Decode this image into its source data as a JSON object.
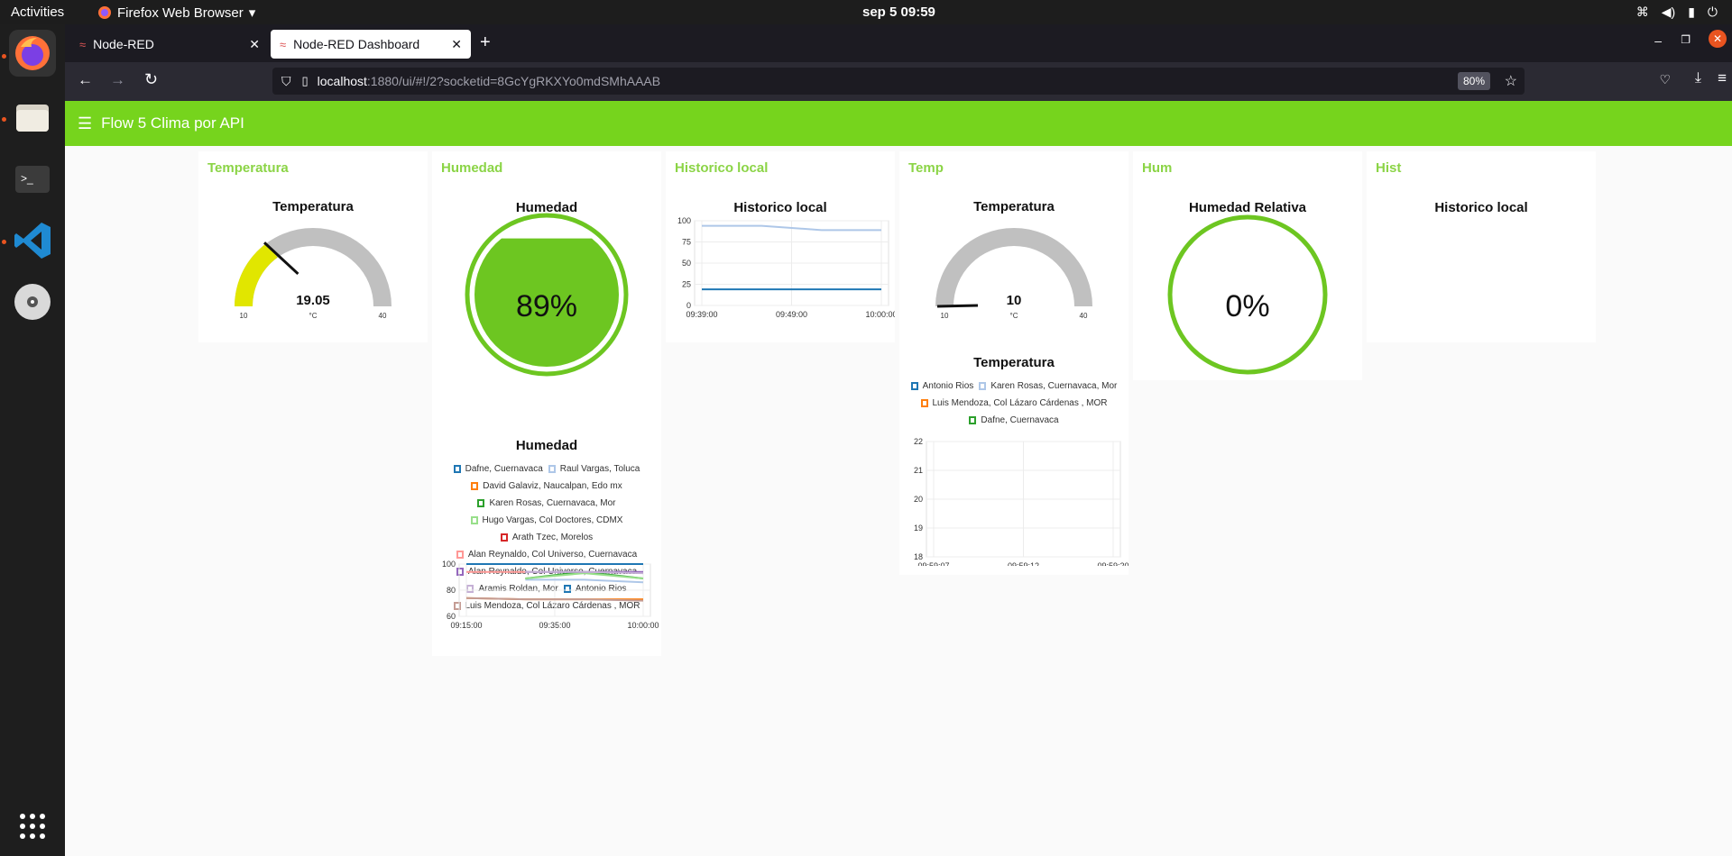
{
  "desktop": {
    "activities": "Activities",
    "app_name": "Firefox Web Browser",
    "clock": "sep 5  09:59"
  },
  "browser": {
    "tabs": [
      {
        "label": "Node-RED",
        "active": false
      },
      {
        "label": "Node-RED Dashboard",
        "active": true
      }
    ],
    "url_host": "localhost",
    "url_rest": ":1880/ui/#!/2?socketid=8GcYgRKXYo0mdSMhAAAB",
    "zoom": "80%"
  },
  "dashboard": {
    "title": "Flow 5 Clima por API",
    "groups": [
      {
        "title": "Temperatura",
        "widgets": [
          {
            "type": "gauge",
            "label": "Temperatura",
            "value": "19.05",
            "unit": "°C",
            "min": "10",
            "max": "40",
            "level": 0.3
          }
        ]
      },
      {
        "title": "Humedad",
        "widgets": [
          {
            "type": "level",
            "label": "Humedad",
            "value": "89%",
            "level": 0.89
          },
          {
            "type": "chart",
            "label": "Humedad"
          }
        ]
      },
      {
        "title": "Historico local",
        "widgets": [
          {
            "type": "chart",
            "label": "Historico local"
          }
        ]
      },
      {
        "title": "Temp",
        "widgets": [
          {
            "type": "gauge",
            "label": "Temperatura",
            "value": "10",
            "unit": "°C",
            "min": "10",
            "max": "40",
            "level": 0.0
          },
          {
            "type": "chart",
            "label": "Temperatura"
          }
        ]
      },
      {
        "title": "Hum",
        "widgets": [
          {
            "type": "level",
            "label": "Humedad Relativa",
            "value": "0%",
            "level": 0.0
          }
        ]
      },
      {
        "title": "Hist",
        "widgets": [
          {
            "type": "chart",
            "label": "Historico local"
          }
        ]
      }
    ]
  },
  "chart_data": [
    {
      "type": "line",
      "title": "Humedad",
      "x": [
        "09:15:00",
        "09:35:00",
        "10:00:00"
      ],
      "ylim": [
        60,
        100
      ],
      "yticks": [
        "100",
        "80",
        "60"
      ],
      "series": [
        {
          "name": "Dafne, Cuernavaca",
          "color": "#1f77b4",
          "values": [
            100,
            100,
            100,
            100
          ]
        },
        {
          "name": "Raul Vargas, Toluca",
          "color": "#aec7e8",
          "values": [
            null,
            88,
            88,
            86
          ]
        },
        {
          "name": "David Galaviz, Naucalpan, Edo mx",
          "color": "#ff7f0e",
          "values": [
            74,
            73,
            73,
            73
          ]
        },
        {
          "name": "Karen Rosas, Cuernavaca, Mor",
          "color": "#2ca02c",
          "values": [
            null,
            89,
            94,
            89
          ]
        },
        {
          "name": "Hugo Vargas, Col Doctores, CDMX",
          "color": "#98df8a",
          "values": [
            null,
            89,
            93,
            89
          ]
        },
        {
          "name": "Arath Tzec, Morelos",
          "color": "#d62728",
          "values": [
            null,
            null,
            null,
            null
          ]
        },
        {
          "name": "Alan Reynaldo, Col Universo, Cuernavaca",
          "color": "#ff9896",
          "values": [
            94,
            94,
            null,
            null
          ]
        },
        {
          "name": "Alan Reynaldo, Col Universo, Cuernavaca",
          "color": "#9467bd",
          "values": [
            null,
            94,
            94,
            94
          ]
        },
        {
          "name": "Aramis Roldan, Mor",
          "color": "#c5b0d5",
          "values": [
            null,
            94,
            94,
            93
          ]
        },
        {
          "name": "Antonio Rios",
          "color": "#1f77b4",
          "values": [
            null,
            null,
            null,
            null
          ]
        },
        {
          "name": "Luis Mendoza, Col Lázaro Cárdenas , MOR",
          "color": "#c49c94",
          "values": [
            74,
            73,
            73,
            72
          ]
        }
      ]
    },
    {
      "type": "line",
      "title": "Historico local",
      "x": [
        "09:39:00",
        "09:49:00",
        "10:00:00"
      ],
      "ylim": [
        0,
        100
      ],
      "yticks": [
        "100",
        "75",
        "50",
        "25",
        "0"
      ],
      "series": [
        {
          "name": "",
          "color": "#aec7e8",
          "values": [
            94,
            94,
            89,
            89
          ]
        },
        {
          "name": "",
          "color": "#1f77b4",
          "values": [
            19,
            19,
            19,
            19
          ]
        }
      ]
    },
    {
      "type": "line",
      "title": "Temperatura",
      "x": [
        "09:59:07",
        "09:59:12",
        "09:59:20"
      ],
      "ylim": [
        18,
        22
      ],
      "yticks": [
        "22",
        "21",
        "20",
        "19",
        "18"
      ],
      "series": [
        {
          "name": "Antonio Rios",
          "color": "#1f77b4",
          "values": []
        },
        {
          "name": "Karen Rosas, Cuernavaca, Mor",
          "color": "#aec7e8",
          "values": []
        },
        {
          "name": "Luis Mendoza, Col Lázaro Cárdenas , MOR",
          "color": "#ff7f0e",
          "values": []
        },
        {
          "name": "Dafne, Cuernavaca",
          "color": "#2ca02c",
          "values": []
        }
      ]
    }
  ]
}
